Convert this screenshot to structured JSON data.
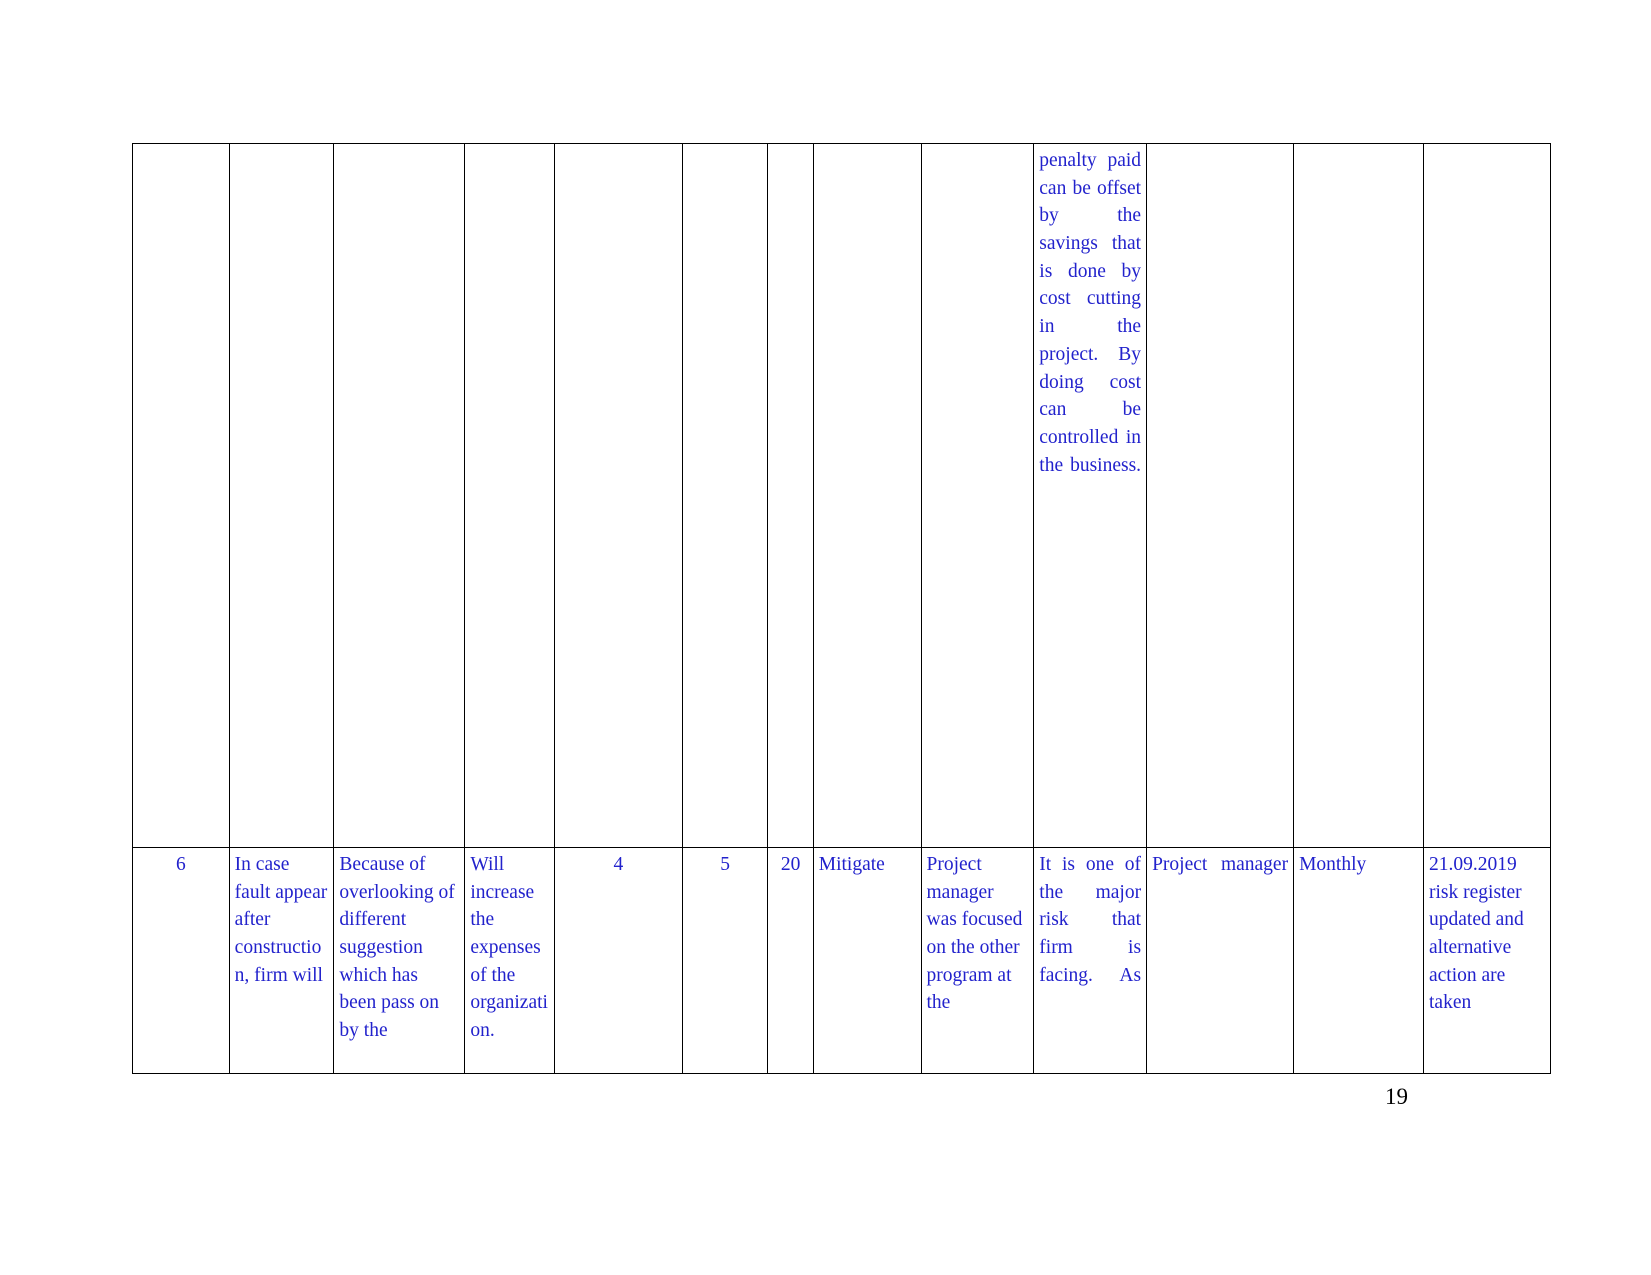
{
  "document": {
    "page_number": "19",
    "text_color": "#2222cc",
    "border_color": "#000000",
    "page_number_color": "#000000"
  },
  "table": {
    "continuation_row": {
      "description_overflow": "penalty paid can be offset by the savings that is done by cost cutting in the project. By doing cost can be controlled in the business."
    },
    "rows": [
      {
        "number": "6",
        "risk": "In case fault appear after construction, firm will",
        "cause": "Because of overlooking of different suggestion which has been pass on by the",
        "effect": "Will increase the expenses of the organization.",
        "probability": "4",
        "impact": "5",
        "score": "20",
        "response": "Mitigate",
        "owner": "Project manager was focused on the other program at the",
        "description": "It is one of the major risk that firm is facing. As",
        "action": "Project manager",
        "frequency": "Monthly",
        "status": "21.09.2019 risk register updated and alternative action are taken"
      }
    ]
  }
}
